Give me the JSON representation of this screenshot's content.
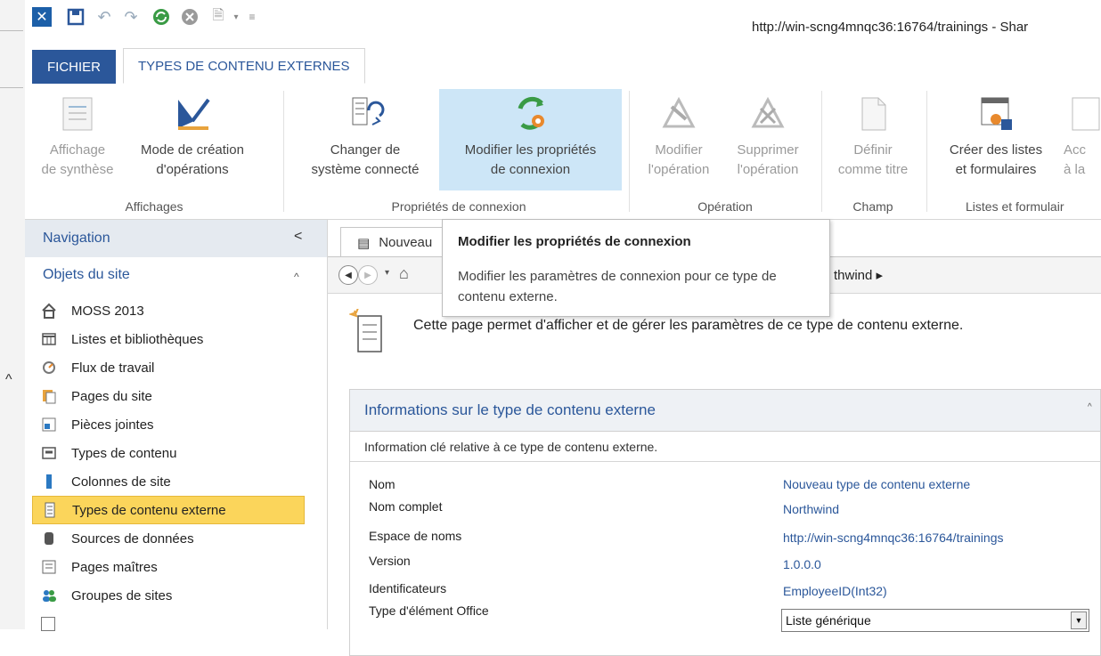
{
  "window": {
    "url_title": "http://win-scng4mnqc36:16764/trainings - Shar"
  },
  "ribbon_tabs": {
    "file": "FICHIER",
    "active": "TYPES DE CONTENU EXTERNES"
  },
  "ribbon": {
    "groups": [
      "Affichages",
      "Propriétés de connexion",
      "Opération",
      "Champ",
      "Listes et formulair"
    ],
    "buttons": {
      "summary": [
        "Affichage",
        "de synthèse"
      ],
      "design": [
        "Mode de création",
        "d'opérations"
      ],
      "change_system": [
        "Changer de",
        "système connecté"
      ],
      "edit_connection": [
        "Modifier les propriétés",
        "de connexion"
      ],
      "edit_operation": [
        "Modifier",
        "l'opération"
      ],
      "delete_operation": [
        "Supprimer",
        "l'opération"
      ],
      "set_title": [
        "Définir",
        "comme titre"
      ],
      "create_lists": [
        "Créer des listes",
        "et formulaires"
      ],
      "partial": [
        "Acc",
        "à la"
      ]
    }
  },
  "tooltip": {
    "title": "Modifier les propriétés de connexion",
    "body": "Modifier les paramètres de connexion pour ce type de contenu externe."
  },
  "nav": {
    "title": "Navigation",
    "collapse": "<",
    "section": "Objets du site",
    "items": [
      {
        "label": "MOSS 2013",
        "icon": "home-icon"
      },
      {
        "label": "Listes et bibliothèques",
        "icon": "list-icon"
      },
      {
        "label": "Flux de travail",
        "icon": "workflow-icon"
      },
      {
        "label": "Pages du site",
        "icon": "site-pages-icon"
      },
      {
        "label": "Pièces jointes",
        "icon": "attachment-icon"
      },
      {
        "label": "Types de contenu",
        "icon": "content-type-icon"
      },
      {
        "label": "Colonnes de site",
        "icon": "column-icon"
      },
      {
        "label": "Types de contenu externe",
        "icon": "external-content-icon"
      },
      {
        "label": "Sources de données",
        "icon": "database-icon"
      },
      {
        "label": "Pages maîtres",
        "icon": "master-page-icon"
      },
      {
        "label": "Groupes de sites",
        "icon": "group-icon"
      }
    ]
  },
  "main": {
    "doc_tab": "Nouveau",
    "breadcrumb_tail": "thwind ▸",
    "intro": "Cette page permet d'afficher et de gérer les paramètres de ce type de contenu externe.",
    "section_title": "Informations sur le type de contenu externe",
    "section_desc": "Information clé relative à ce type de contenu externe.",
    "fields": [
      {
        "label": "Nom",
        "value": "Nouveau type de contenu externe"
      },
      {
        "label": "Nom complet",
        "value": "Northwind"
      },
      {
        "label": "Espace de noms",
        "value": "http://win-scng4mnqc36:16764/trainings"
      },
      {
        "label": "Version",
        "value": "1.0.0.0"
      },
      {
        "label": "Identificateurs",
        "value": "EmployeeID(Int32)"
      },
      {
        "label": "Type d'élément Office",
        "value": "Liste générique"
      }
    ]
  },
  "colors": {
    "accent": "#2b579a",
    "selected": "#fbd55b",
    "hover": "#cde6f7"
  }
}
